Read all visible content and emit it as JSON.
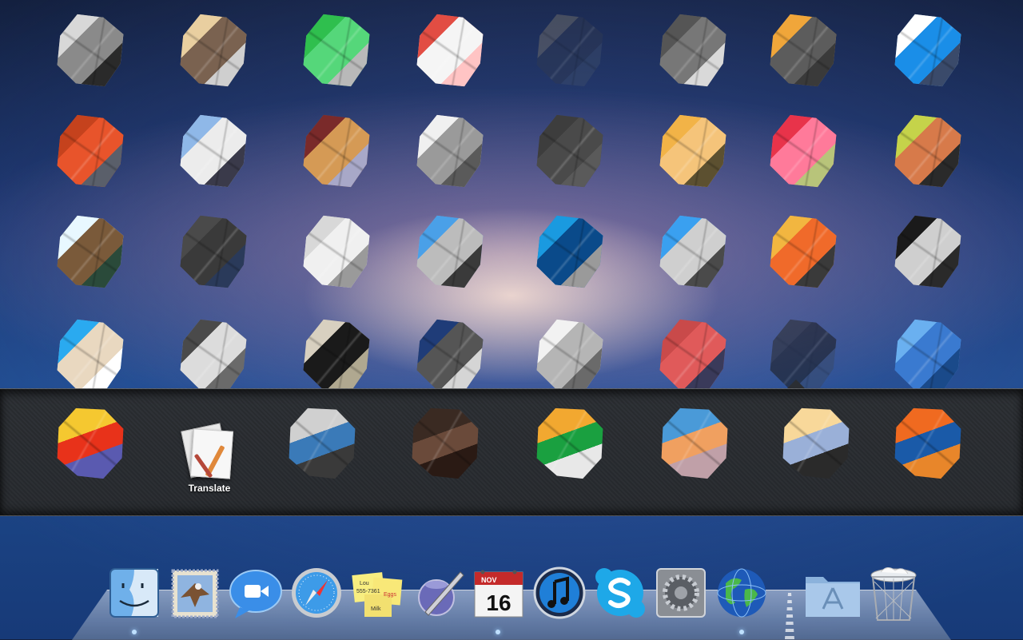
{
  "launchpad": {
    "grid_icons": [
      {
        "name": "app-1",
        "colors": [
          "#d8d8d8",
          "#8a8a8a",
          "#2a2a2a"
        ]
      },
      {
        "name": "app-2",
        "colors": [
          "#e9cfa0",
          "#7a6250",
          "#cfcfcf"
        ]
      },
      {
        "name": "app-3",
        "colors": [
          "#2fbf4e",
          "#55d77a",
          "#b9b9b9"
        ]
      },
      {
        "name": "app-4",
        "colors": [
          "#e24d43",
          "#f5f5f5",
          "#ffc4c4"
        ]
      },
      {
        "name": "app-5",
        "colors": [
          "#6a6a6a",
          "#2e3a55",
          "#3a4a6a"
        ]
      },
      {
        "name": "app-6",
        "colors": [
          "#555",
          "#777",
          "#d9d9d9"
        ]
      },
      {
        "name": "app-7",
        "colors": [
          "#f0a63a",
          "#5c5c5c",
          "#3a3a3a"
        ]
      },
      {
        "name": "app-8",
        "colors": [
          "#ffffff",
          "#1a8ee8",
          "#3a4a6a"
        ]
      },
      {
        "name": "app-9",
        "colors": [
          "#c5421d",
          "#e8542b",
          "#5a5f6a"
        ]
      },
      {
        "name": "app-10",
        "colors": [
          "#8fb8e8",
          "#ececec",
          "#3a3a4a"
        ]
      },
      {
        "name": "app-11",
        "colors": [
          "#7a2a2a",
          "#d59a55",
          "#a8a8c8"
        ]
      },
      {
        "name": "app-12",
        "colors": [
          "#f0f0f0",
          "#9a9a9a",
          "#5a5a5a"
        ]
      },
      {
        "name": "app-13",
        "colors": [
          "#3d3d3d",
          "#4a4a4a",
          "#5a5a5a"
        ]
      },
      {
        "name": "app-14",
        "colors": [
          "#f2b347",
          "#f5c47a",
          "#5c5030"
        ]
      },
      {
        "name": "app-15",
        "colors": [
          "#e8334a",
          "#ff7a9a",
          "#b8c47a"
        ]
      },
      {
        "name": "app-16",
        "colors": [
          "#c5d34a",
          "#d77a4a",
          "#2a2a2a"
        ]
      },
      {
        "name": "app-17",
        "colors": [
          "#e8f8ff",
          "#7a5a3a",
          "#2a4a3a"
        ]
      },
      {
        "name": "app-18",
        "colors": [
          "#4a4a4a",
          "#3a3a3a",
          "#2a3a5a"
        ]
      },
      {
        "name": "app-19",
        "colors": [
          "#d8d8d8",
          "#f0f0f0",
          "#9a9a9a"
        ]
      },
      {
        "name": "app-20",
        "colors": [
          "#4aa0e8",
          "#bcbcbc",
          "#3a3a3a"
        ]
      },
      {
        "name": "app-21",
        "colors": [
          "#1a9ae0",
          "#0a4a8a",
          "#9a9a9a"
        ]
      },
      {
        "name": "app-22",
        "colors": [
          "#3aa0f0",
          "#cfcfcf",
          "#4a4a4a"
        ]
      },
      {
        "name": "app-23",
        "colors": [
          "#f2b640",
          "#f06a2a",
          "#3a3a3a"
        ]
      },
      {
        "name": "app-24",
        "colors": [
          "#1a1a1a",
          "#cfcfcf",
          "#2a2a2a"
        ]
      },
      {
        "name": "app-25",
        "colors": [
          "#2aaaf0",
          "#e9d8c0",
          "#ffffff"
        ]
      },
      {
        "name": "app-26",
        "colors": [
          "#4a4a4a",
          "#dcdcdc",
          "#6a6a6a"
        ]
      },
      {
        "name": "app-27",
        "colors": [
          "#d8d0c0",
          "#1a1a1a",
          "#b0a890"
        ]
      },
      {
        "name": "app-28",
        "colors": [
          "#1f3c78",
          "#555",
          "#d5d5d5"
        ]
      },
      {
        "name": "app-29",
        "colors": [
          "#f2f2f2",
          "#b5b5b5",
          "#6a6a6a"
        ]
      },
      {
        "name": "app-30",
        "colors": [
          "#c94a4a",
          "#e05a5a",
          "#3a3a5a"
        ]
      },
      {
        "name": "app-31",
        "colors": [
          "#2a2a2a",
          "#1a1a1a",
          "#3a4a6a"
        ]
      },
      {
        "name": "app-32",
        "colors": [
          "#6ab0f0",
          "#3a7ad0",
          "#1a4a8a"
        ]
      }
    ],
    "folder": {
      "apps": [
        {
          "name": "folder-app-1",
          "colors": [
            "#f5c830",
            "#e8321a",
            "#5a5ab0"
          ]
        },
        {
          "name": "translate",
          "label": "Translate"
        },
        {
          "name": "folder-app-3",
          "colors": [
            "#d0d0d0",
            "#3a7ab8",
            "#3a3a3a"
          ]
        },
        {
          "name": "folder-app-4",
          "colors": [
            "#3a2a22",
            "#6a4a3a",
            "#2a1a14"
          ]
        },
        {
          "name": "folder-app-5",
          "colors": [
            "#f2a830",
            "#1aa040",
            "#e8e8e8"
          ]
        },
        {
          "name": "folder-app-6",
          "colors": [
            "#4a9ad8",
            "#f0a060",
            "#c0a0a8"
          ]
        },
        {
          "name": "folder-app-7",
          "colors": [
            "#f8d89a",
            "#9ab0d8",
            "#2a2a2a"
          ]
        },
        {
          "name": "folder-app-8",
          "colors": [
            "#f06a20",
            "#1a5aa8",
            "#e8862a"
          ]
        }
      ]
    }
  },
  "dock": {
    "items": [
      {
        "name": "finder",
        "label": "Finder"
      },
      {
        "name": "mail",
        "label": "Mail"
      },
      {
        "name": "facetime",
        "label": "FaceTime"
      },
      {
        "name": "safari",
        "label": "Safari"
      },
      {
        "name": "stickies",
        "label": "Stickies",
        "notes": [
          "Lou",
          "555-7361",
          "Eggs",
          "Milk"
        ]
      },
      {
        "name": "pages",
        "label": "Pages"
      },
      {
        "name": "calendar",
        "label": "Calendar",
        "month": "NOV",
        "day": "16"
      },
      {
        "name": "itunes",
        "label": "iTunes"
      },
      {
        "name": "skype",
        "label": "Skype"
      },
      {
        "name": "system-preferences",
        "label": "System Preferences"
      },
      {
        "name": "network",
        "label": "Network"
      },
      {
        "name": "applications",
        "label": "Applications"
      },
      {
        "name": "trash",
        "label": "Trash"
      }
    ]
  }
}
